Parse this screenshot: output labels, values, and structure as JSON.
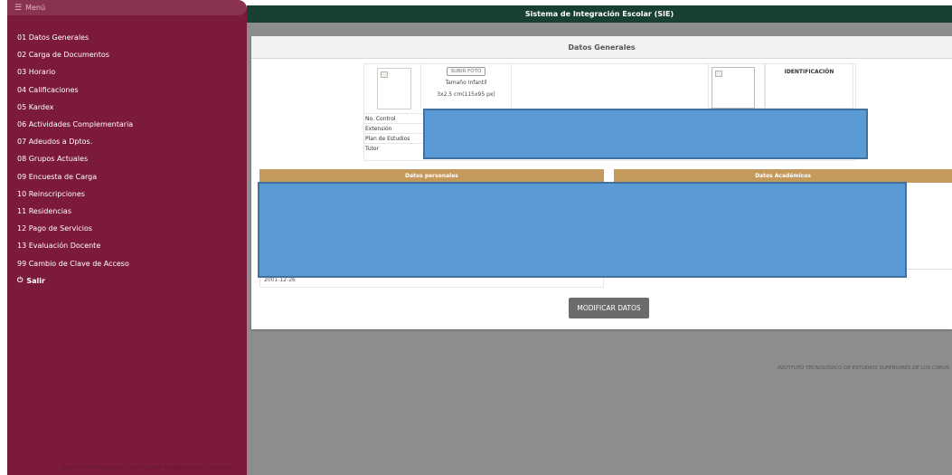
{
  "menu": {
    "header_label": "Menú",
    "items": [
      "01 Datos Generales",
      "02 Carga de Documentos",
      "03 Horario",
      "04 Calificaciones",
      "05 Kardex",
      "06 Actividades Complementaria",
      "07 Adeudos a Dptos.",
      "08 Grupos Actuales",
      "09 Encuesta de Carga",
      "10 Reinscripciones",
      "11 Residencias",
      "12 Pago de Servicios",
      "13 Evaluación Docente",
      "99 Cambio de Clave de Acceso"
    ],
    "logout_label": "Salir",
    "footer": "INSTITUTO TECNOLÓGICO DE ESTUDIOS SUPERIORES DE LOS CABOS"
  },
  "topbar": {
    "title": "Sistema de Integración Escolar (SIE)"
  },
  "panel": {
    "title": "Datos Generales",
    "upload_button": "SUBIR FOTO",
    "photo_size_label": "Tamaño Infantil",
    "photo_size_dims": "3x2.5 cm(115x95 px)",
    "id_label": "IDENTIFICACIÓN",
    "fields": [
      "No. Control",
      "Extensión",
      "Plan de Estudios",
      "Tutor"
    ],
    "personal_header": "Datos personales",
    "academic_header": "Datos Académicos",
    "birthdate": "2001-12-26",
    "modify_button": "MODIFICAR DATOS"
  },
  "footer_right": "INSTITUTO TECNOLÓGICO DE ESTUDIOS SUPERIORES DE LOS CABOS",
  "colors": {
    "sidebar": "#7b1a3a",
    "topbar": "#173f32",
    "section_header": "#c49a5c",
    "redaction": "#5b9bd5",
    "content_bg": "#8d8d8d"
  }
}
